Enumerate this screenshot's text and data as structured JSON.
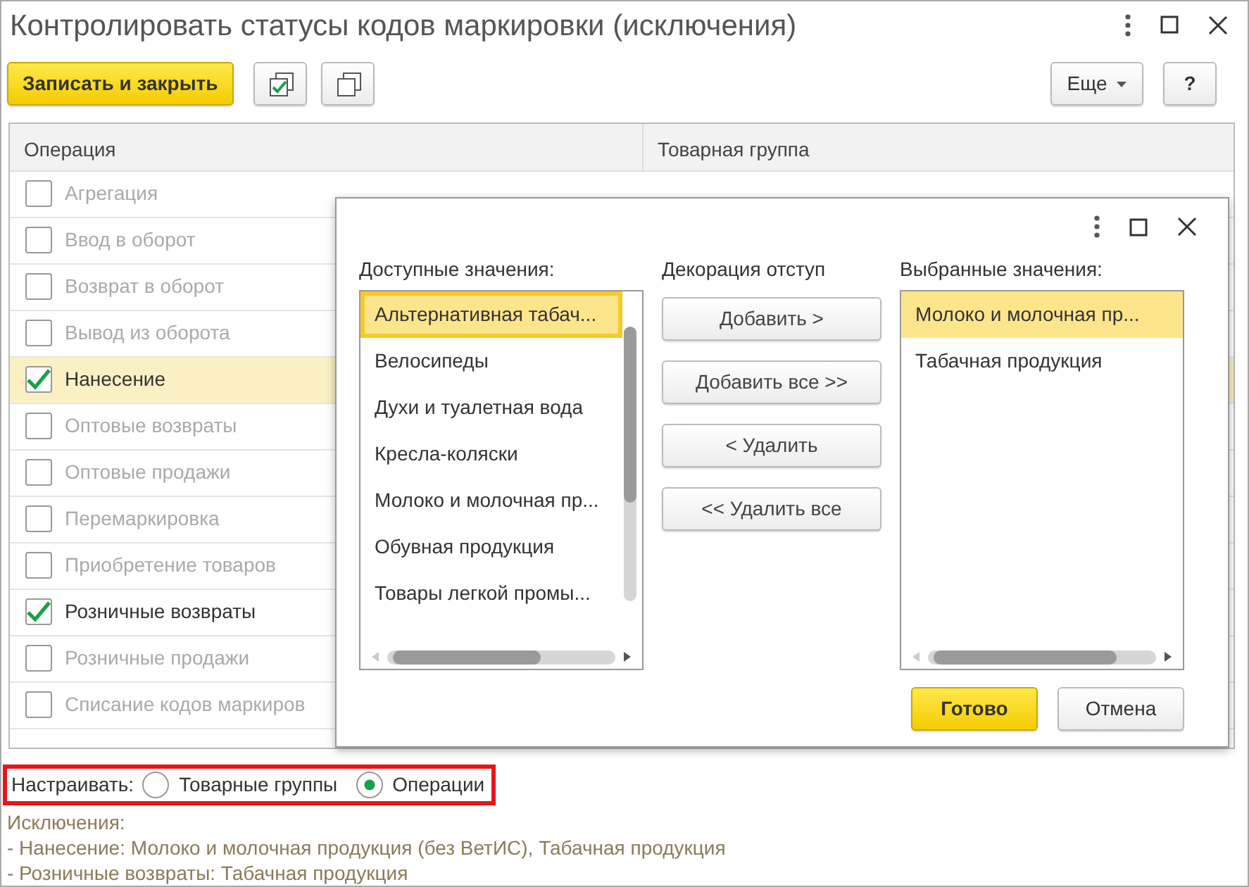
{
  "window": {
    "title": "Контролировать статусы кодов маркировки (исключения)"
  },
  "toolbar": {
    "save_button": "Записать и закрыть",
    "more_button": "Еще",
    "help_button": "?"
  },
  "table": {
    "columns": [
      "Операция",
      "Товарная группа"
    ],
    "rows": [
      {
        "operation": "Агрегация",
        "checked": false,
        "selected": false
      },
      {
        "operation": "Ввод в оборот",
        "checked": false,
        "selected": false
      },
      {
        "operation": "Возврат в оборот",
        "checked": false,
        "selected": false
      },
      {
        "operation": "Вывод из оборота",
        "checked": false,
        "selected": false
      },
      {
        "operation": "Нанесение",
        "checked": true,
        "selected": true
      },
      {
        "operation": "Оптовые возвраты",
        "checked": false,
        "selected": false
      },
      {
        "operation": "Оптовые продажи",
        "checked": false,
        "selected": false
      },
      {
        "operation": "Перемаркировка",
        "checked": false,
        "selected": false
      },
      {
        "operation": "Приобретение товаров",
        "checked": false,
        "selected": false
      },
      {
        "operation": "Розничные возвраты",
        "checked": true,
        "selected": false
      },
      {
        "operation": "Розничные продажи",
        "checked": false,
        "selected": false
      },
      {
        "operation": "Списание кодов маркиров",
        "checked": false,
        "selected": false
      }
    ]
  },
  "dialog": {
    "available_label": "Доступные значения:",
    "middle_label": "Декорация отступ",
    "chosen_label": "Выбранные значения:",
    "available": [
      {
        "text": "Альтернативная табач...",
        "selected": true
      },
      {
        "text": "Велосипеды",
        "selected": false
      },
      {
        "text": "Духи и туалетная вода",
        "selected": false
      },
      {
        "text": "Кресла-коляски",
        "selected": false
      },
      {
        "text": "Молоко и молочная пр...",
        "selected": false
      },
      {
        "text": "Обувная продукция",
        "selected": false
      },
      {
        "text": "Товары легкой промы...",
        "selected": false
      }
    ],
    "actions": [
      "Добавить >",
      "Добавить все >>",
      "< Удалить",
      "<< Удалить все"
    ],
    "chosen": [
      {
        "text": "Молоко и молочная пр...",
        "selected": true
      },
      {
        "text": "Табачная продукция",
        "selected": false
      }
    ],
    "ok_button": "Готово",
    "cancel_button": "Отмена"
  },
  "setting": {
    "label": "Настраивать:",
    "options": [
      {
        "label": "Товарные группы",
        "selected": false
      },
      {
        "label": "Операции",
        "selected": true
      }
    ]
  },
  "exceptions": [
    "Исключения:",
    "- Нанесение: Молоко и молочная продукция (без ВетИС), Табачная продукция",
    "- Розничные возвраты: Табачная продукция"
  ]
}
